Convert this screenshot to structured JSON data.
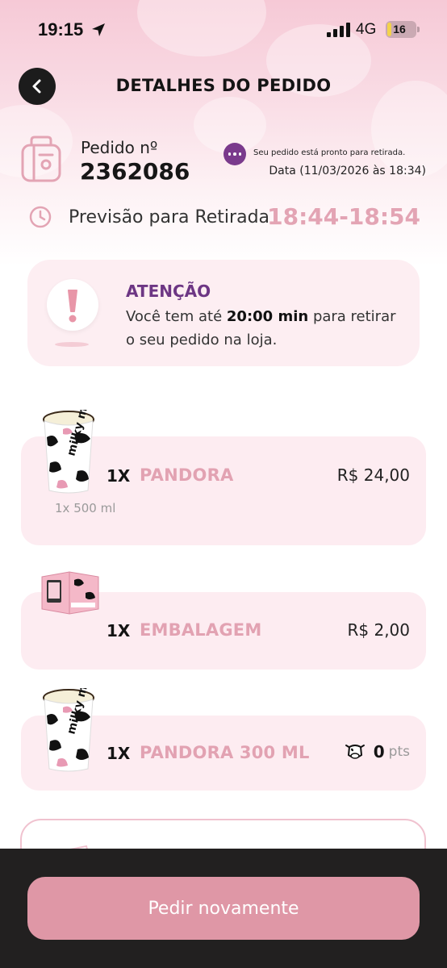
{
  "status_bar": {
    "time": "19:15",
    "network": "4G",
    "battery_level": "16",
    "battery_fraction": 0.16
  },
  "header": {
    "title": "DETALHES DO PEDIDO",
    "back_icon": "chevron-left-icon"
  },
  "order": {
    "label": "Pedido nº",
    "number": "2362086",
    "status": "Seu pedido está pronto para retirada.",
    "date": "Data (11/03/2026 às 18:34)"
  },
  "pickup": {
    "label": "Previsão para Retirada",
    "time": "18:44-18:54"
  },
  "attention": {
    "title": "ATENÇÃO",
    "text_before": "Você tem até ",
    "highlight": "20:00 min",
    "text_after": " para retirar o seu pedido na loja."
  },
  "items": [
    {
      "qty": "1X",
      "name": "PANDORA",
      "price": "R$ 24,00",
      "detail": "1x 500 ml"
    },
    {
      "qty": "1X",
      "name": "EMBALAGEM",
      "price": "R$ 2,00"
    },
    {
      "qty": "1X",
      "name": "PANDORA 300 ML",
      "points_value": "0",
      "points_unit": "pts"
    }
  ],
  "cup_brand_text": "milky moo",
  "actions": {
    "reorder_label": "Pedir novamente"
  },
  "colors": {
    "accent_pink": "#e2a2b2",
    "purple": "#6d3684",
    "button_pink": "#df97a6",
    "card_pink": "#fdecf1"
  }
}
